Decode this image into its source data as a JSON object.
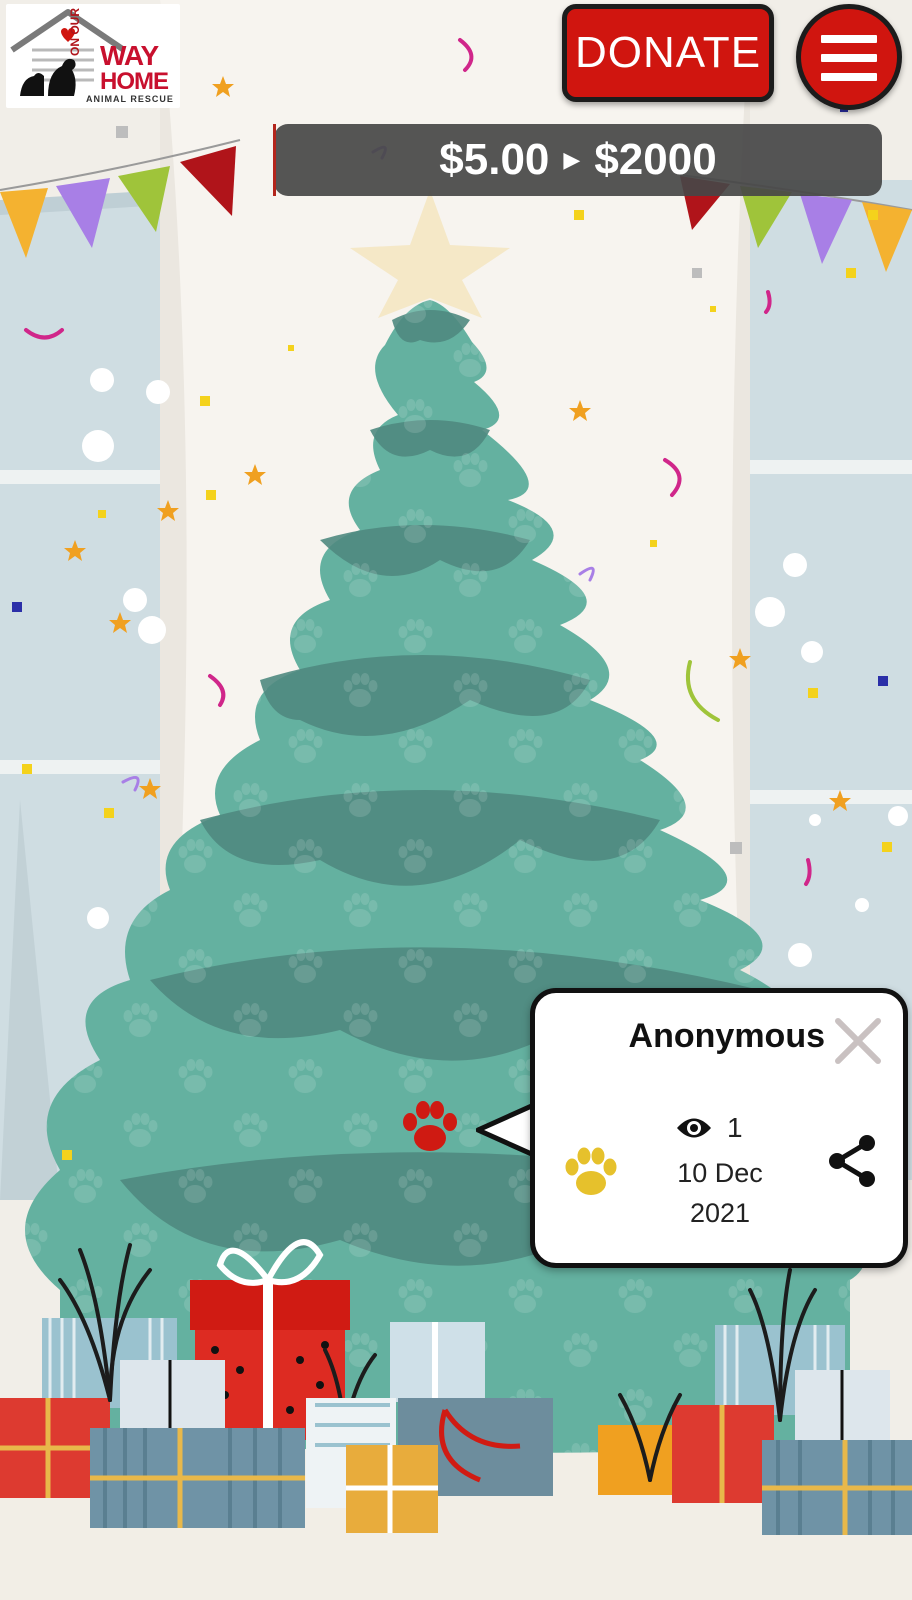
{
  "logo": {
    "line1": "WAY",
    "line2": "HOME",
    "vertical": "ON OUR",
    "subtitle": "ANIMAL RESCUE"
  },
  "header": {
    "donate_label": "DONATE",
    "menu_icon": "hamburger-icon"
  },
  "goal": {
    "raised": "$5.00",
    "target": "$2000",
    "separator_icon": "play-arrow-icon",
    "progress_fraction": 0.0025
  },
  "popup": {
    "donor_name": "Anonymous",
    "views": "1",
    "date_line1": "10 Dec",
    "date_line2": "2021",
    "icons": [
      "close-icon",
      "eye-icon",
      "paw-icon",
      "share-icon"
    ]
  },
  "colors": {
    "accent_red": "#d0150f",
    "tree_green": "#64b1a0",
    "tree_dark": "#4f8a80",
    "paw_gold": "#e6c12c",
    "paw_red": "#cf1a12"
  }
}
